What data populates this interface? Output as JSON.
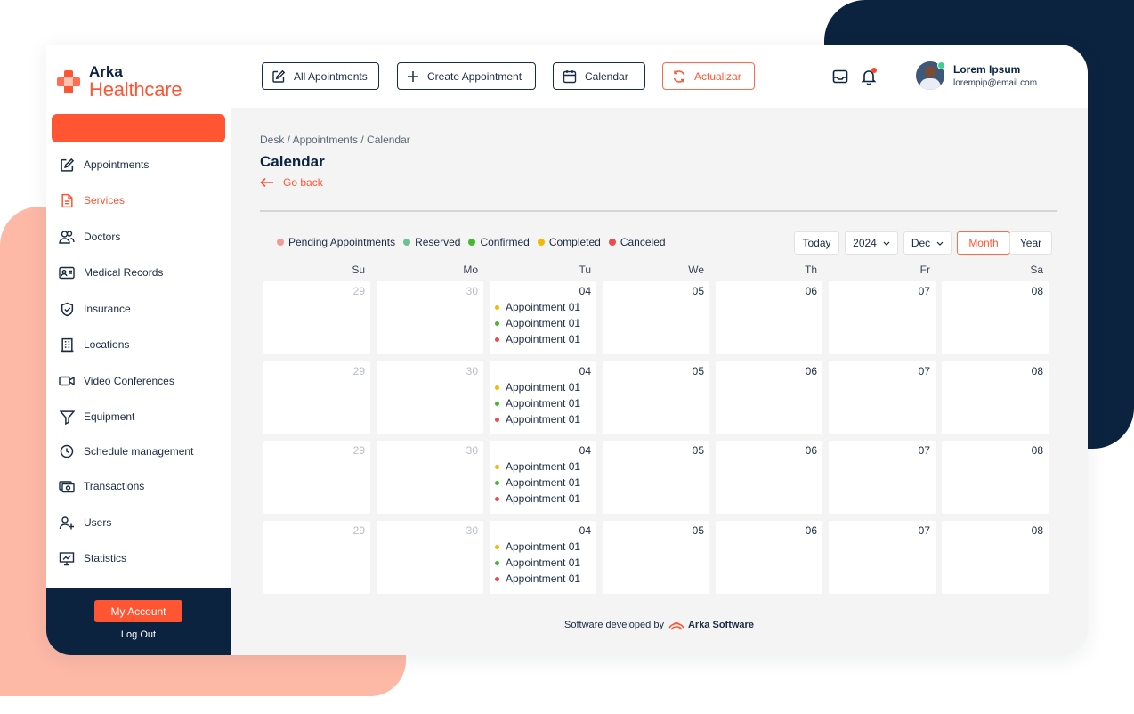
{
  "brand": {
    "line1": "Arka",
    "line2": "Healthcare",
    "accent": "#ff5533",
    "navy": "#0c2340"
  },
  "topbar": {
    "all_appointments": "All Apointments",
    "create_appointment": "Create Appointment",
    "calendar": "Calendar",
    "refresh": "Actualizar",
    "mail_icon": "mail-icon",
    "bell_icon": "bell-icon"
  },
  "user": {
    "name": "Lorem Ipsum",
    "email": "lorempip@email.com"
  },
  "sidebar": {
    "items": [
      {
        "label": "Appointments",
        "icon": "edit-icon"
      },
      {
        "label": "Services",
        "icon": "document-icon"
      },
      {
        "label": "Doctors",
        "icon": "users-icon"
      },
      {
        "label": "Medical Records",
        "icon": "id-card-icon"
      },
      {
        "label": "Insurance",
        "icon": "shield-icon"
      },
      {
        "label": "Locations",
        "icon": "building-icon"
      },
      {
        "label": "Video Conferences",
        "icon": "video-icon"
      },
      {
        "label": "Equipment",
        "icon": "funnel-icon"
      },
      {
        "label": "Schedule management",
        "icon": "clock-icon"
      },
      {
        "label": "Transactions",
        "icon": "cash-icon"
      },
      {
        "label": "Users",
        "icon": "user-plus-icon"
      },
      {
        "label": "Statistics",
        "icon": "presentation-chart-icon"
      }
    ],
    "selected": "Services",
    "my_account": "My Account",
    "log_out": "Log Out"
  },
  "page": {
    "breadcrumb": "Desk / Appointments / Calendar",
    "title": "Calendar",
    "go_back": "Go back"
  },
  "legend": [
    {
      "label": "Pending Appointments",
      "color": "#f29a9a"
    },
    {
      "label": "Reserved",
      "color": "#6cc28f"
    },
    {
      "label": "Confirmed",
      "color": "#44b82e"
    },
    {
      "label": "Completed",
      "color": "#f5b800"
    },
    {
      "label": "Canceled",
      "color": "#ef4b4b"
    }
  ],
  "controls": {
    "today": "Today",
    "year": "2024",
    "month_select": "Dec",
    "view_month": "Month",
    "view_year": "Year",
    "active_view": "Month"
  },
  "weekdays": [
    "Su",
    "Mo",
    "Tu",
    "We",
    "Th",
    "Fr",
    "Sa"
  ],
  "weeks": [
    {
      "days": [
        "29",
        "30",
        "04",
        "05",
        "06",
        "07",
        "08"
      ]
    },
    {
      "days": [
        "29",
        "30",
        "04",
        "05",
        "06",
        "07",
        "08"
      ]
    },
    {
      "days": [
        "29",
        "30",
        "04",
        "05",
        "06",
        "07",
        "08"
      ]
    },
    {
      "days": [
        "29",
        "30",
        "04",
        "05",
        "06",
        "07",
        "08"
      ]
    }
  ],
  "muted_days": [
    0,
    1
  ],
  "appointments": [
    {
      "label": "Appointment 01",
      "color": "#f5b800"
    },
    {
      "label": "Appointment 01",
      "color": "#44b82e"
    },
    {
      "label": "Appointment 01",
      "color": "#ef4b4b"
    }
  ],
  "footer": {
    "text": "Software developed by",
    "brand": "Arka Software"
  }
}
